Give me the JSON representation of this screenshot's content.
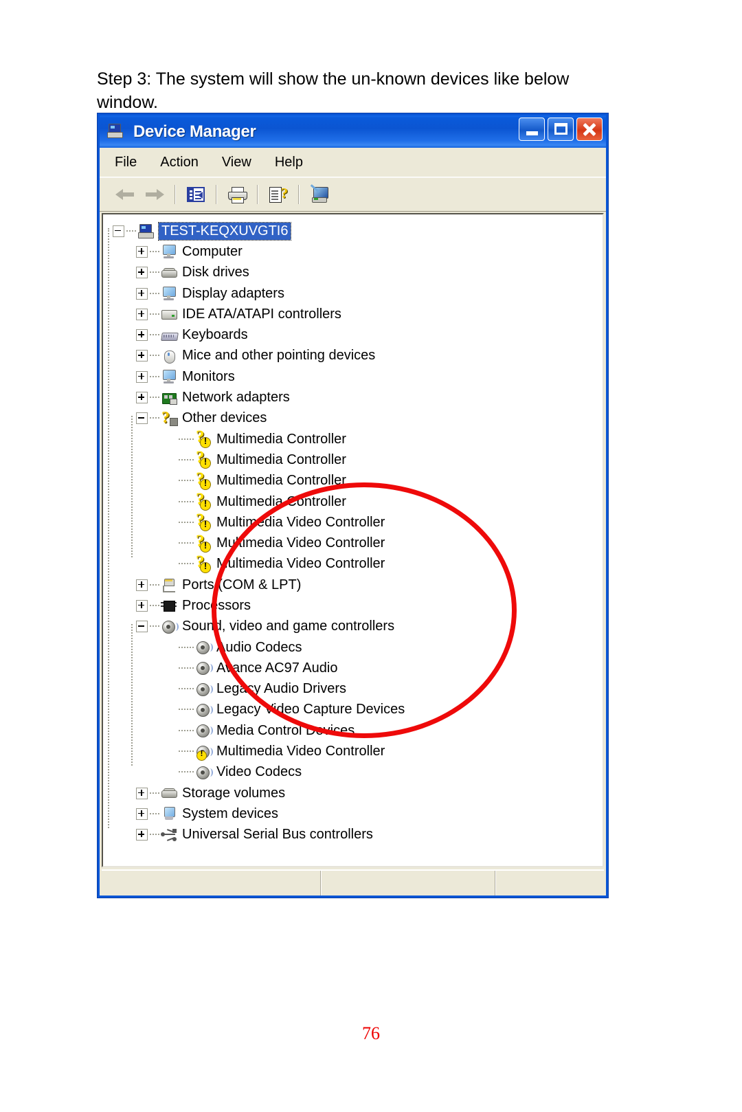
{
  "document": {
    "step_text": "Step 3: The system will show the un-known devices like below window.",
    "page_number": "76"
  },
  "window": {
    "title": "Device Manager",
    "title_icon": "computer-icon",
    "controls": {
      "minimize": "_",
      "maximize": "□",
      "close": "✕"
    },
    "menu": [
      {
        "label": "File"
      },
      {
        "label": "Action"
      },
      {
        "label": "View"
      },
      {
        "label": "Help"
      }
    ],
    "toolbar": [
      {
        "name": "back-icon",
        "enabled": false
      },
      {
        "name": "forward-icon",
        "enabled": false
      },
      {
        "name": "show-hide-console-tree-icon",
        "enabled": true
      },
      {
        "name": "print-properties-icon",
        "enabled": true
      },
      {
        "name": "help-icon",
        "enabled": true
      },
      {
        "name": "scan-for-hardware-changes-icon",
        "enabled": true
      }
    ],
    "status_bar": {
      "pane1": "",
      "pane2": "",
      "pane3": ""
    }
  },
  "annotation": {
    "shape": "ellipse",
    "color": "#ee0a0a",
    "targets": "Other devices branch with unknown multimedia controllers"
  },
  "tree": {
    "root": {
      "label": "TEST-KEQXUVGTI6",
      "icon": "computer-icon",
      "selected": true,
      "expanded": true
    },
    "items": [
      {
        "label": "Computer",
        "icon": "monitor-icon",
        "level": 1,
        "expander": "plus",
        "warn": false
      },
      {
        "label": "Disk drives",
        "icon": "disk-icon",
        "level": 1,
        "expander": "plus",
        "warn": false
      },
      {
        "label": "Display adapters",
        "icon": "monitor-icon",
        "level": 1,
        "expander": "plus",
        "warn": false
      },
      {
        "label": "IDE ATA/ATAPI controllers",
        "icon": "ide-icon",
        "level": 1,
        "expander": "plus",
        "warn": false
      },
      {
        "label": "Keyboards",
        "icon": "keyboard-icon",
        "level": 1,
        "expander": "plus",
        "warn": false
      },
      {
        "label": "Mice and other pointing devices",
        "icon": "mouse-icon",
        "level": 1,
        "expander": "plus",
        "warn": false
      },
      {
        "label": "Monitors",
        "icon": "monitor-icon",
        "level": 1,
        "expander": "plus",
        "warn": false
      },
      {
        "label": "Network adapters",
        "icon": "network-icon",
        "level": 1,
        "expander": "plus",
        "warn": false
      },
      {
        "label": "Other devices",
        "icon": "question-icon",
        "level": 1,
        "expander": "minus",
        "warn": false
      },
      {
        "label": "Multimedia Controller",
        "icon": "question-warning-icon",
        "level": 2,
        "expander": "none",
        "warn": true
      },
      {
        "label": "Multimedia Controller",
        "icon": "question-warning-icon",
        "level": 2,
        "expander": "none",
        "warn": true
      },
      {
        "label": "Multimedia Controller",
        "icon": "question-warning-icon",
        "level": 2,
        "expander": "none",
        "warn": true
      },
      {
        "label": "Multimedia Controller",
        "icon": "question-warning-icon",
        "level": 2,
        "expander": "none",
        "warn": true
      },
      {
        "label": "Multimedia Video Controller",
        "icon": "question-warning-icon",
        "level": 2,
        "expander": "none",
        "warn": true
      },
      {
        "label": "Multimedia Video Controller",
        "icon": "question-warning-icon",
        "level": 2,
        "expander": "none",
        "warn": true
      },
      {
        "label": "Multimedia Video Controller",
        "icon": "question-warning-icon",
        "level": 2,
        "expander": "none",
        "warn": true
      },
      {
        "label": "Ports (COM & LPT)",
        "icon": "port-icon",
        "level": 1,
        "expander": "plus",
        "warn": false
      },
      {
        "label": "Processors",
        "icon": "cpu-icon",
        "level": 1,
        "expander": "plus",
        "warn": false
      },
      {
        "label": "Sound, video and game controllers",
        "icon": "speaker-icon",
        "level": 1,
        "expander": "minus",
        "warn": false
      },
      {
        "label": "Audio Codecs",
        "icon": "speaker-icon",
        "level": 2,
        "expander": "none",
        "warn": false
      },
      {
        "label": "Avance AC97 Audio",
        "icon": "speaker-icon",
        "level": 2,
        "expander": "none",
        "warn": false
      },
      {
        "label": "Legacy Audio Drivers",
        "icon": "speaker-icon",
        "level": 2,
        "expander": "none",
        "warn": false
      },
      {
        "label": "Legacy Video Capture Devices",
        "icon": "speaker-icon",
        "level": 2,
        "expander": "none",
        "warn": false
      },
      {
        "label": "Media Control Devices",
        "icon": "speaker-icon",
        "level": 2,
        "expander": "none",
        "warn": false
      },
      {
        "label": "Multimedia Video Controller",
        "icon": "speaker-warning-icon",
        "level": 2,
        "expander": "none",
        "warn": true
      },
      {
        "label": "Video Codecs",
        "icon": "speaker-icon",
        "level": 2,
        "expander": "none",
        "warn": false
      },
      {
        "label": "Storage volumes",
        "icon": "disk-icon",
        "level": 1,
        "expander": "plus",
        "warn": false
      },
      {
        "label": "System devices",
        "icon": "system-icon",
        "level": 1,
        "expander": "plus",
        "warn": false
      },
      {
        "label": "Universal Serial Bus controllers",
        "icon": "usb-icon",
        "level": 1,
        "expander": "plus",
        "warn": false
      }
    ]
  }
}
